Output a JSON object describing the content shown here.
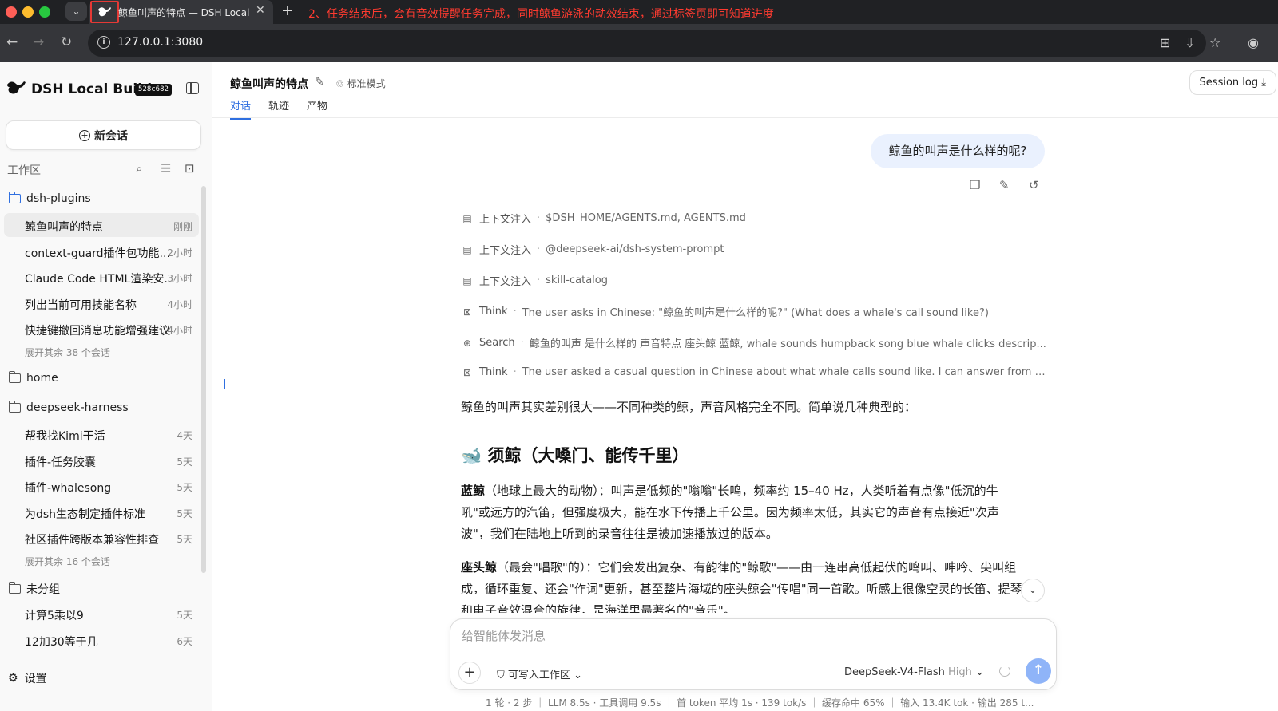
{
  "browser": {
    "tab_title": "鲸鱼叫声的特点 — DSH Local Build",
    "annotation": "2、任务结束后，会有音效提醒任务完成，同时鲸鱼游泳的动效结束，通过标签页即可知道进度",
    "url": "127.0.0.1:3080",
    "tab_icon": "whale-icon",
    "traffic_colors": [
      "#ff5f57",
      "#febc2e",
      "#28c840"
    ]
  },
  "sidebar": {
    "brand": "DSH Local Build",
    "build": "528c682",
    "new_chat": "新会话",
    "workspace_label": "工作区",
    "groups": [
      {
        "name": "dsh-plugins",
        "sessions": [
          {
            "title": "鲸鱼叫声的特点",
            "time": "刚刚"
          },
          {
            "title": "context-guard插件包功能...",
            "time": "2小时"
          },
          {
            "title": "Claude Code HTML渲染安...",
            "time": "3小时"
          },
          {
            "title": "列出当前可用技能名称",
            "time": "4小时"
          },
          {
            "title": "快捷键撤回消息功能增强建议",
            "time": "4小时"
          }
        ],
        "expand": "展开其余 38 个会话"
      },
      {
        "name": "home"
      },
      {
        "name": "deepseek-harness",
        "sessions": [
          {
            "title": "帮我找Kimi干活",
            "time": "4天"
          },
          {
            "title": "插件-任务胶囊",
            "time": "5天"
          },
          {
            "title": "插件-whalesong",
            "time": "5天"
          },
          {
            "title": "为dsh生态制定插件标准",
            "time": "5天"
          },
          {
            "title": "社区插件跨版本兼容性排查",
            "time": "5天"
          }
        ],
        "expand": "展开其余 16 个会话"
      },
      {
        "name": "未分组",
        "sessions": [
          {
            "title": "计算5乘以9",
            "time": "5天"
          },
          {
            "title": "12加30等于几",
            "time": "6天"
          }
        ]
      }
    ],
    "settings": "设置"
  },
  "header": {
    "title": "鲸鱼叫声的特点",
    "mode": "标准模式",
    "tabs": [
      "对话",
      "轨迹",
      "产物"
    ],
    "session_log": "Session log"
  },
  "conversation": {
    "user_message": "鲸鱼的叫声是什么样的呢?",
    "steps": [
      {
        "icon": "document-icon",
        "label": "上下文注入",
        "detail": "$DSH_HOME/AGENTS.md, AGENTS.md"
      },
      {
        "icon": "document-icon",
        "label": "上下文注入",
        "detail": "@deepseek-ai/dsh-system-prompt"
      },
      {
        "icon": "document-icon",
        "label": "上下文注入",
        "detail": "skill-catalog"
      },
      {
        "icon": "think-icon",
        "label": "Think",
        "detail": "The user asks in Chinese: \"鲸鱼的叫声是什么样的呢?\" (What does a whale's call sound like?)"
      },
      {
        "icon": "globe-icon",
        "label": "Search",
        "detail": "鲸鱼的叫声 是什么样的 声音特点 座头鲸 蓝鲸, whale sounds humpback song blue whale clicks descrip..."
      },
      {
        "icon": "think-icon",
        "label": "Think",
        "detail": "The user asked a casual question in Chinese about what whale calls sound like. I can answer from kno..."
      }
    ],
    "answer_intro": "鲸鱼的叫声其实差别很大——不同种类的鲸，声音风格完全不同。简单说几种典型的：",
    "answer_heading": "🐋 须鲸（大嗓门、能传千里）",
    "paragraphs": [
      {
        "bold": "蓝鲸",
        "text": "（地球上最大的动物）：叫声是低频的\"嗡嗡\"长鸣，频率约 15–40 Hz，人类听着有点像\"低沉的牛吼\"或远方的汽笛，但强度极大，能在水下传播上千公里。因为频率太低，其实它的声音有点接近\"次声波\"，我们在陆地上听到的录音往往是被加速播放过的版本。"
      },
      {
        "bold": "座头鲸",
        "text": "（最会\"唱歌\"的）：它们会发出复杂、有韵律的\"鲸歌\"——由一连串高低起伏的鸣叫、呻吟、尖叫组成，循环重复、还会\"作词\"更新，甚至整片海域的座头鲸会\"传唱\"同一首歌。听感上很像空灵的长笛、提琴和电子音效混合的旋律，是海洋里最著名的\"音乐\"。"
      }
    ]
  },
  "composer": {
    "placeholder": "给智能体发消息",
    "permission": "可写入工作区",
    "model": "DeepSeek-V4-Flash",
    "level": "High",
    "stats": "1 轮 · 2 步 ｜ LLM 8.5s · 工具调用 9.5s ｜ 首 token 平均 1s · 139 tok/s ｜ 缓存命中 65% ｜ 输入 13.4K tok · 输出 285 t..."
  }
}
